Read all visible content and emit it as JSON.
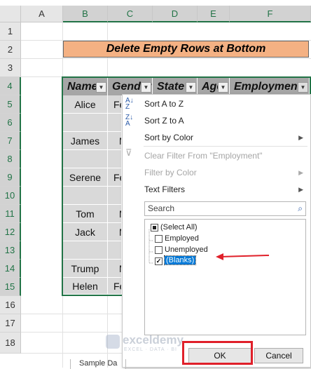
{
  "columns": [
    "A",
    "B",
    "C",
    "D",
    "E",
    "F"
  ],
  "rows": [
    "1",
    "2",
    "3",
    "4",
    "5",
    "6",
    "7",
    "8",
    "9",
    "10",
    "11",
    "12",
    "13",
    "14",
    "15",
    "16",
    "17",
    "18"
  ],
  "title": "Delete Empty Rows at Bottom",
  "table": {
    "headers": [
      "Name",
      "Gender",
      "State",
      "Age",
      "Employment"
    ],
    "names": [
      "Alice",
      "",
      "James",
      "",
      "Serene",
      "",
      "Tom",
      "Jack",
      "",
      "Trump",
      "Helen"
    ],
    "gender_partials": [
      "Fe",
      "",
      "M",
      "",
      "Fe",
      "",
      "M",
      "M",
      "",
      "M",
      "Fe"
    ]
  },
  "filter_menu": {
    "sort_az": "Sort A to Z",
    "sort_za": "Sort Z to A",
    "sort_color": "Sort by Color",
    "clear_filter": "Clear Filter From \"Employment\"",
    "filter_color": "Filter by Color",
    "text_filters": "Text Filters",
    "search_placeholder": "Search",
    "list": [
      {
        "label": "(Select All)",
        "state": "partial"
      },
      {
        "label": "Employed",
        "state": "unchecked"
      },
      {
        "label": "Unemployed",
        "state": "unchecked"
      },
      {
        "label": "(Blanks)",
        "state": "checked"
      }
    ],
    "ok": "OK",
    "cancel": "Cancel"
  },
  "watermark": {
    "brand": "exceldemy",
    "tagline": "EXCEL · DATA · BI"
  },
  "sheet_tab": "Sample Da",
  "colors": {
    "accent_green": "#217346",
    "title_fill": "#f4b183",
    "annotation_red": "#e0202a"
  }
}
